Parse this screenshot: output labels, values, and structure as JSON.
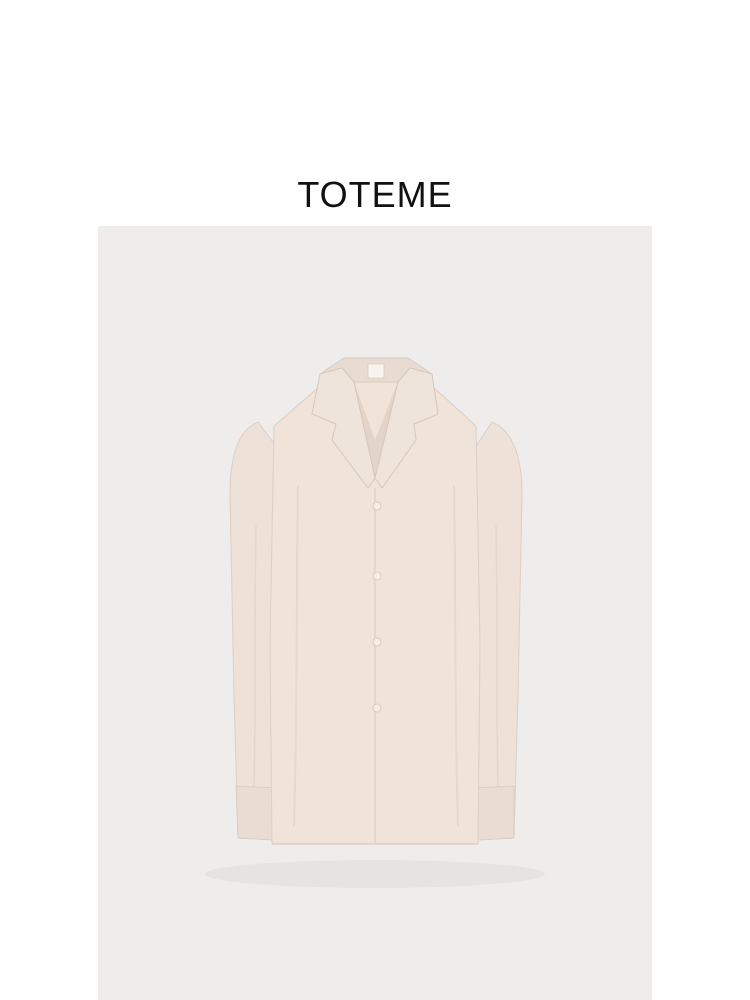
{
  "brand": {
    "name": "TOTEME"
  },
  "product_image": {
    "subject": "shirt-illustration",
    "colors": {
      "backdrop": "#eeedec",
      "fabric": "#efe3da",
      "fabric_shadow": "#e1d2c7",
      "button": "#f5eee8",
      "label": "#f7f3ef"
    }
  }
}
